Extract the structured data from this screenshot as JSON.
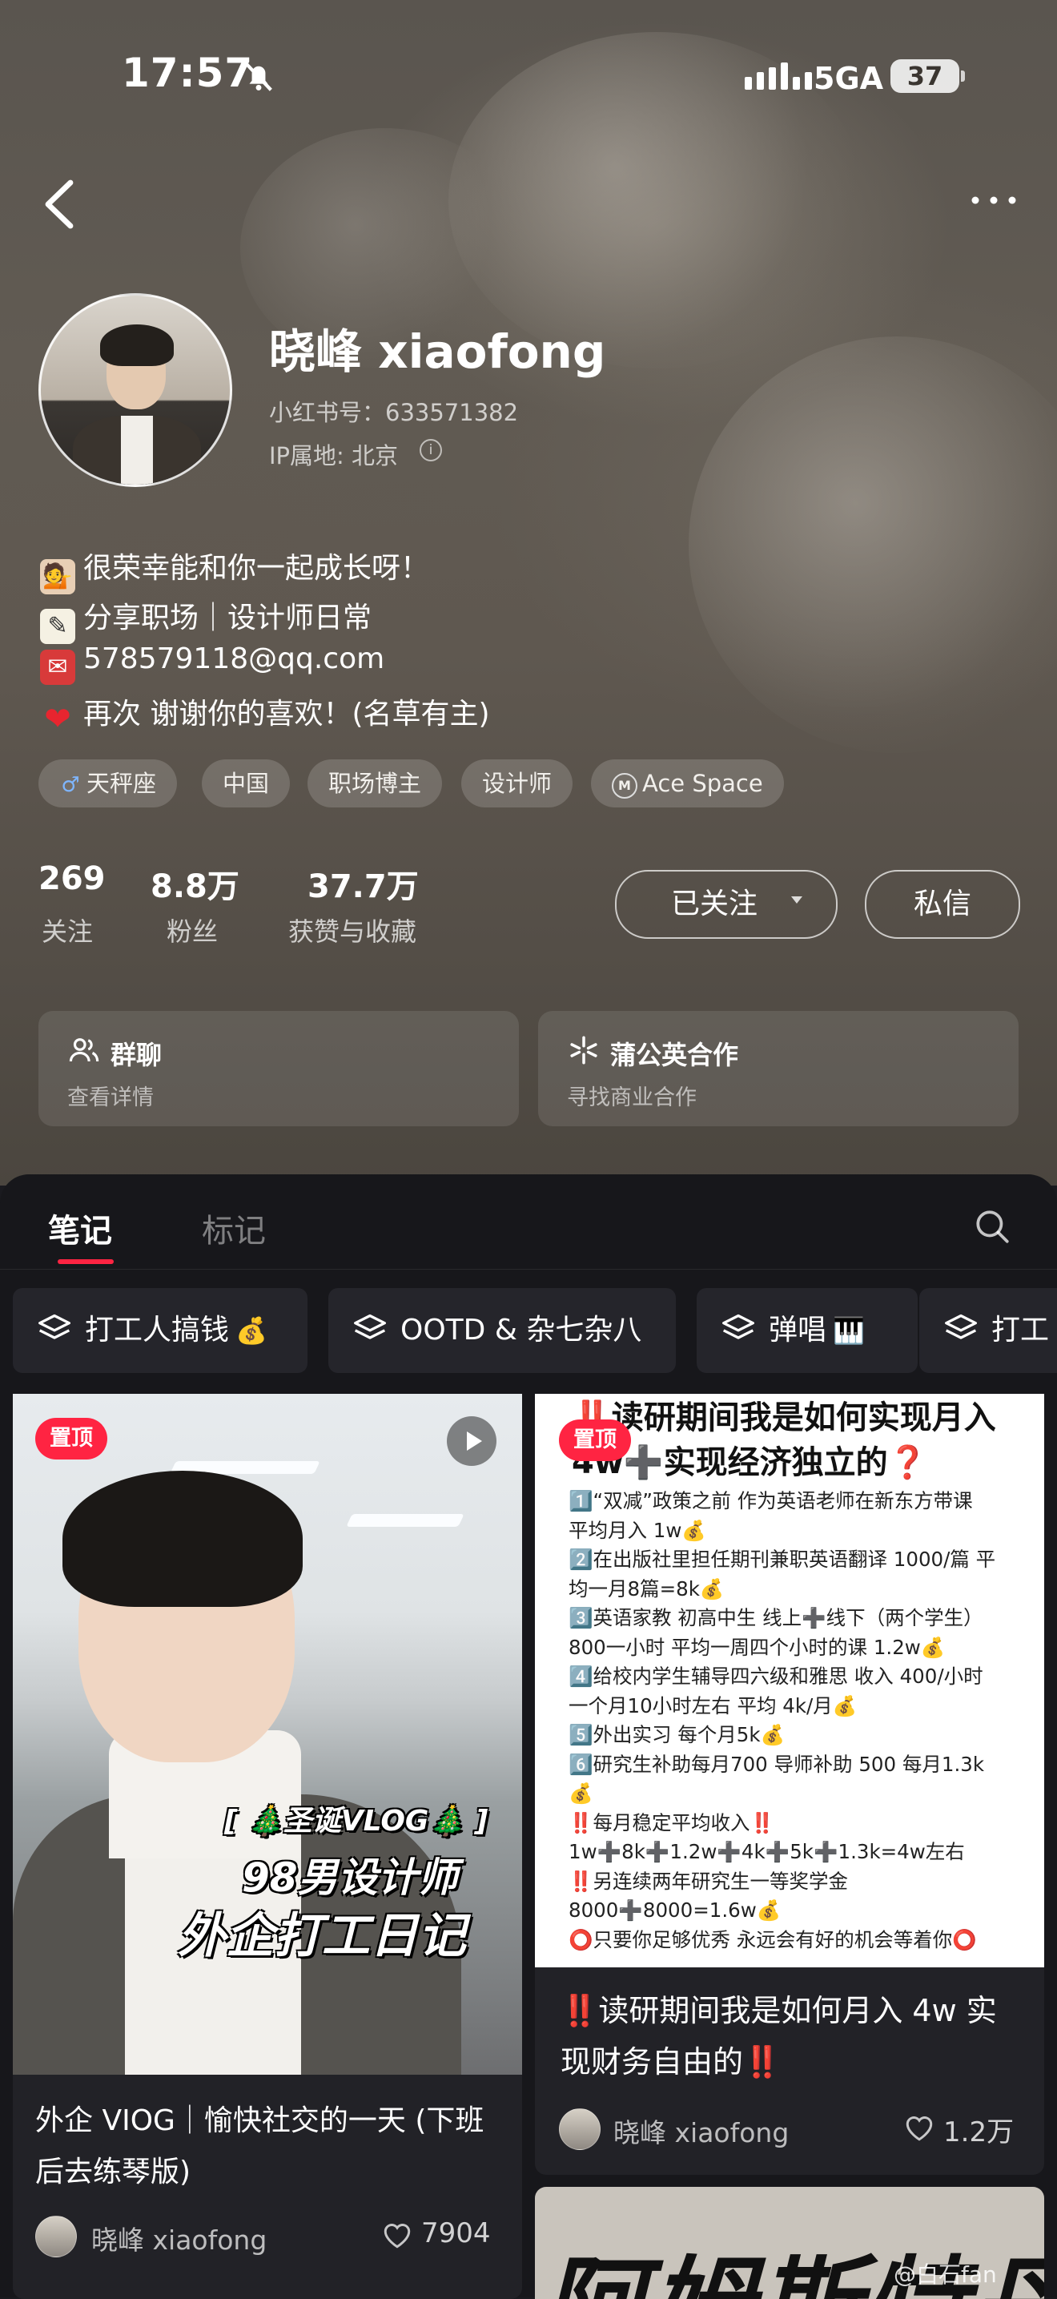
{
  "status_bar": {
    "time": "17:57",
    "network": "5GA",
    "battery": "37"
  },
  "profile": {
    "nickname": "晓峰 xiaofong",
    "redbook_id": "小红书号：633571382",
    "ip_location": "IP属地: 北京",
    "bio": [
      {
        "icon": "person-tipping-hand-icon",
        "text": "很荣幸能和你一起成长呀！"
      },
      {
        "icon": "memo-icon",
        "text": "分享职场｜设计师日常"
      },
      {
        "icon": "postbox-icon",
        "text": "578579118@qq.com"
      },
      {
        "icon": "red-heart-icon",
        "text": "再次 谢谢你的喜欢！(名草有主)"
      }
    ],
    "tags": [
      {
        "icon": "male-symbol-icon",
        "label": "天秤座"
      },
      {
        "icon": "",
        "label": "中国"
      },
      {
        "icon": "",
        "label": "职场博主"
      },
      {
        "icon": "",
        "label": "设计师"
      },
      {
        "icon": "mcn-icon",
        "label": "Ace Space"
      }
    ],
    "stats": [
      {
        "value": "269",
        "label": "关注"
      },
      {
        "value": "8.8万",
        "label": "粉丝"
      },
      {
        "value": "37.7万",
        "label": "获赞与收藏"
      }
    ],
    "follow_label": "已关注",
    "dm_label": "私信",
    "quick_links": [
      {
        "icon": "group-chat-icon",
        "title": "群聊",
        "subtitle": "查看详情"
      },
      {
        "icon": "pugongying-icon",
        "title": "蒲公英合作",
        "subtitle": "寻找商业合作"
      }
    ]
  },
  "tabs": {
    "notes": "笔记",
    "marks": "标记",
    "active": "notes"
  },
  "collections": [
    {
      "label": "打工人搞钱",
      "emoji": "💰"
    },
    {
      "label": "OOTD & 杂七杂八",
      "emoji": ""
    },
    {
      "label": "弹唱",
      "emoji": "🎹"
    },
    {
      "label": "打工",
      "emoji": ""
    }
  ],
  "feed": {
    "pin_label": "置顶",
    "card1": {
      "overlay_line1": "[ 🎄圣诞VLOG🎄 ]",
      "overlay_line2": "98男设计师",
      "overlay_line3": "外企打工日记",
      "title": "外企 VIOG｜愉快社交的一天 (下班后去练琴版)",
      "author": "晓峰 xiaofong",
      "likes": "7904"
    },
    "card2": {
      "headline": "‼️读研期间我是如何实现月入4w➕实现经济独立的❓",
      "lines": [
        "1️⃣“双减”政策之前 作为英语老师在新东方带课",
        "平均月入 1w💰",
        "2️⃣在出版社里担任期刊兼职英语翻译 1000/篇 平",
        "均一月8篇=8k💰",
        "3️⃣英语家教 初高中生 线上➕线下（两个学生）",
        "800一小时  平均一周四个小时的课 1.2w💰",
        "4️⃣给校内学生辅导四六级和雅思 收入 400/小时",
        "一个月10小时左右 平均 4k/月💰",
        "5️⃣外出实习 每个月5k💰",
        "6️⃣研究生补助每月700 导师补助 500 每月1.3k",
        "💰",
        "‼️每月稳定平均收入‼️",
        "1w➕8k➕1.2w➕4k➕5k➕1.3k=4w左右",
        "‼️另连续两年研究生一等奖学金",
        "8000➕8000=1.6w💰",
        "⭕只要你足够优秀 永远会有好的机会等着你⭕"
      ],
      "title": "‼️读研期间我是如何月入 4w 实现财务自由的‼️",
      "author": "晓峰 xiaofong",
      "likes": "1.2万"
    },
    "card3": {
      "cover_text": "阿姆斯特丹"
    }
  },
  "watermark": "@白石fan"
}
